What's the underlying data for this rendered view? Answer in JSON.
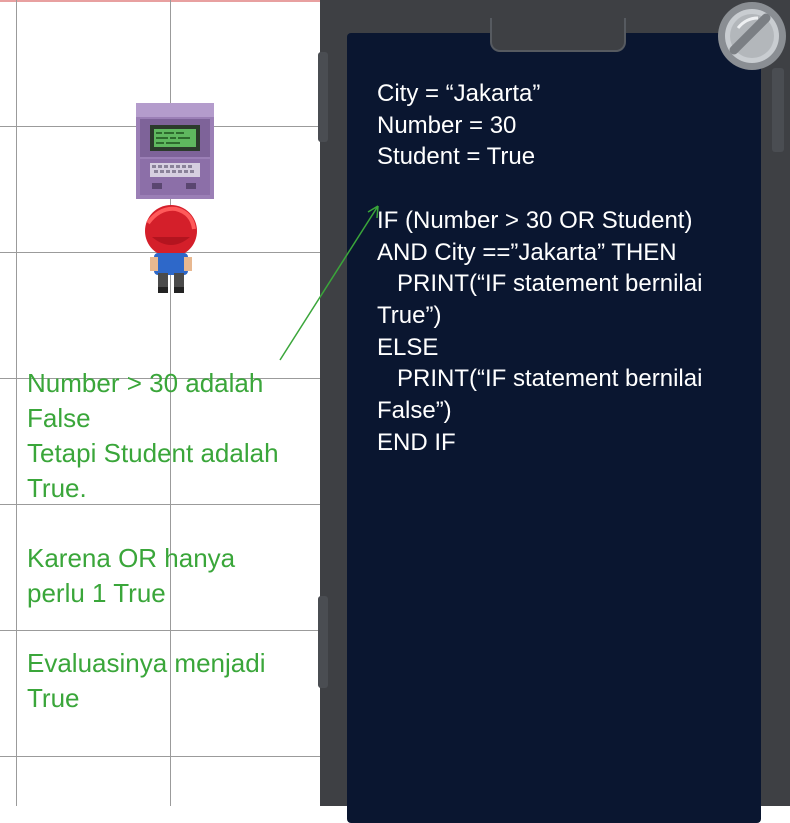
{
  "explanation": {
    "line1": "Number > 30 adalah",
    "line2": "False",
    "line3": "Tetapi Student adalah",
    "line4": "True.",
    "line5": "Karena OR hanya",
    "line6": "perlu 1  True",
    "line7": "Evaluasinya menjadi",
    "line8": "True"
  },
  "code": {
    "line1": "City = “Jakarta”",
    "line2": "Number = 30",
    "line3": "Student = True",
    "line4": "",
    "line5": "IF (Number > 30 OR Student)",
    "line6": "AND City ==”Jakarta” THEN",
    "line7": "   PRINT(“IF statement bernilai",
    "line8": "True”)",
    "line9": "ELSE",
    "line10": "   PRINT(“IF statement bernilai",
    "line11": "False”)",
    "line12": "END IF"
  },
  "colors": {
    "annotation": "#3aa63a",
    "screen": "#0a1630",
    "bezel": "#3e4044"
  },
  "icons": {
    "terminal": "computer-terminal-icon",
    "player": "player-character",
    "close": "close-orb-icon"
  }
}
